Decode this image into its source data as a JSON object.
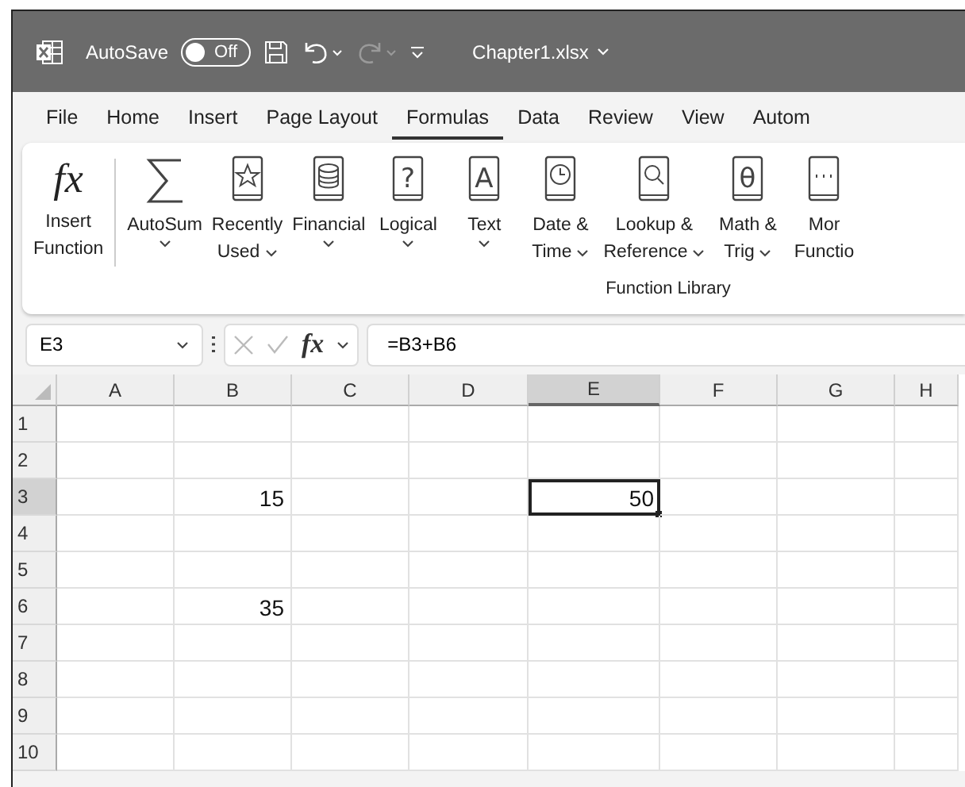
{
  "title_bar": {
    "autosave_label": "AutoSave",
    "autosave": {
      "on": false,
      "label": "Off"
    },
    "redo_disabled": true,
    "file_name": "Chapter1.xlsx"
  },
  "tabs": [
    {
      "label": "File",
      "selected": false
    },
    {
      "label": "Home",
      "selected": false
    },
    {
      "label": "Insert",
      "selected": false
    },
    {
      "label": "Page Layout",
      "selected": false
    },
    {
      "label": "Formulas",
      "selected": true
    },
    {
      "label": "Data",
      "selected": false
    },
    {
      "label": "Review",
      "selected": false
    },
    {
      "label": "View",
      "selected": false
    },
    {
      "label": "Autom",
      "selected": false
    }
  ],
  "ribbon": {
    "group_label": "Function Library",
    "buttons": [
      {
        "kind": "fx",
        "glyph": "fx",
        "lines": [
          "Insert",
          "Function"
        ],
        "dropdown": false
      },
      {
        "kind": "sum",
        "lines": [
          "AutoSum"
        ],
        "dropdown": true
      },
      {
        "kind": "star",
        "lines": [
          "Recently",
          "Used"
        ],
        "dropdown": true
      },
      {
        "kind": "coins",
        "lines": [
          "Financial"
        ],
        "dropdown": true
      },
      {
        "kind": "glyph",
        "glyph": "?",
        "lines": [
          "Logical"
        ],
        "dropdown": true
      },
      {
        "kind": "glyph",
        "glyph": "A",
        "lines": [
          "Text"
        ],
        "dropdown": true
      },
      {
        "kind": "clock",
        "lines": [
          "Date &",
          "Time"
        ],
        "dropdown": true
      },
      {
        "kind": "search",
        "lines": [
          "Lookup &",
          "Reference"
        ],
        "dropdown": true
      },
      {
        "kind": "glyph",
        "glyph": "θ",
        "lines": [
          "Math &",
          "Trig"
        ],
        "dropdown": true
      },
      {
        "kind": "dots",
        "lines": [
          "Mor",
          "Functio"
        ],
        "dropdown": false
      }
    ]
  },
  "formula_bar": {
    "name_box": "E3",
    "fx_label": "fx",
    "formula": "=B3+B6"
  },
  "grid": {
    "columns": [
      {
        "label": "A",
        "selected": false
      },
      {
        "label": "B",
        "selected": false
      },
      {
        "label": "C",
        "selected": false
      },
      {
        "label": "D",
        "selected": false
      },
      {
        "label": "E",
        "selected": true
      },
      {
        "label": "F",
        "selected": false
      },
      {
        "label": "G",
        "selected": false
      },
      {
        "label": "H",
        "selected": false
      }
    ],
    "rows": [
      {
        "label": "1",
        "selected": false,
        "cells": [
          null,
          null,
          null,
          null,
          null,
          null,
          null,
          null
        ]
      },
      {
        "label": "2",
        "selected": false,
        "cells": [
          null,
          null,
          null,
          null,
          null,
          null,
          null,
          null
        ]
      },
      {
        "label": "3",
        "selected": true,
        "cells": [
          null,
          {
            "value": "15",
            "selected": false
          },
          null,
          null,
          {
            "value": "50",
            "selected": true
          },
          null,
          null,
          null
        ]
      },
      {
        "label": "4",
        "selected": false,
        "cells": [
          null,
          null,
          null,
          null,
          null,
          null,
          null,
          null
        ]
      },
      {
        "label": "5",
        "selected": false,
        "cells": [
          null,
          null,
          null,
          null,
          null,
          null,
          null,
          null
        ]
      },
      {
        "label": "6",
        "selected": false,
        "cells": [
          null,
          {
            "value": "35",
            "selected": false
          },
          null,
          null,
          null,
          null,
          null,
          null
        ]
      },
      {
        "label": "7",
        "selected": false,
        "cells": [
          null,
          null,
          null,
          null,
          null,
          null,
          null,
          null
        ]
      },
      {
        "label": "8",
        "selected": false,
        "cells": [
          null,
          null,
          null,
          null,
          null,
          null,
          null,
          null
        ]
      },
      {
        "label": "9",
        "selected": false,
        "cells": [
          null,
          null,
          null,
          null,
          null,
          null,
          null,
          null
        ]
      },
      {
        "label": "10",
        "selected": false,
        "cells": [
          null,
          null,
          null,
          null,
          null,
          null,
          null,
          null
        ]
      }
    ]
  }
}
